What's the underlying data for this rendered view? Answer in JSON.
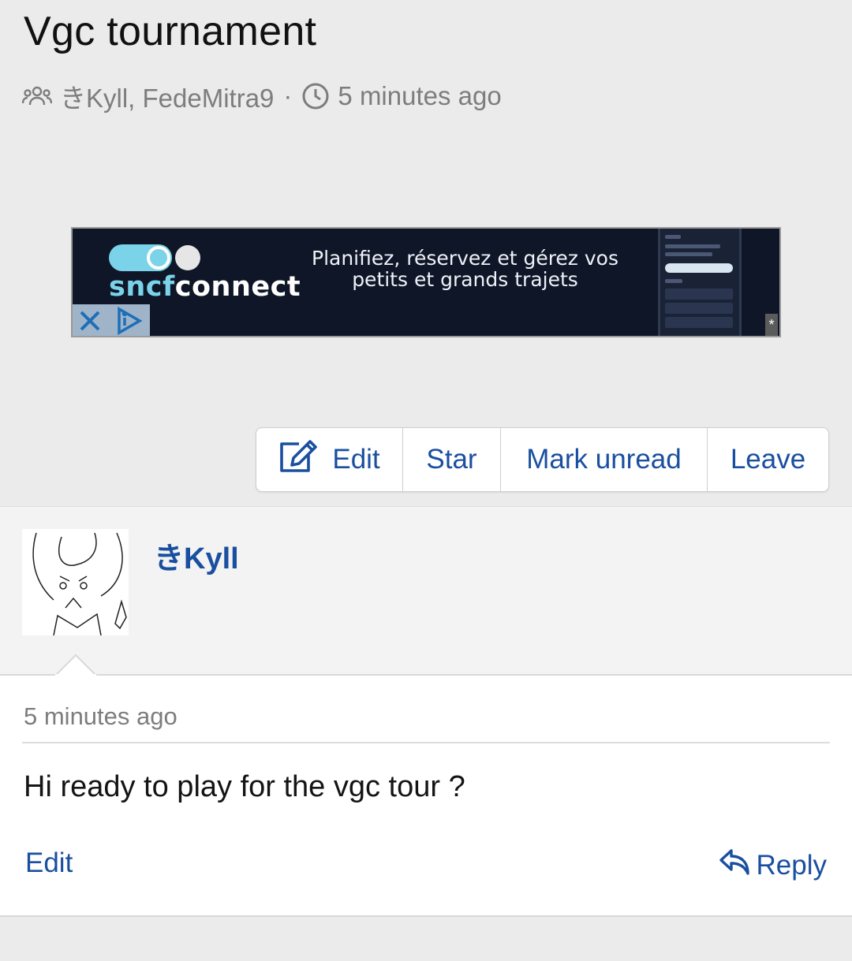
{
  "thread": {
    "title": "Vgc tournament",
    "participants": "きKyll, FedeMitra9",
    "separator": "·",
    "time": "5 minutes ago"
  },
  "ad": {
    "brand_part1": "sncf",
    "brand_part2": "connect",
    "slogan_line1": "Planifiez, réservez et gérez vos",
    "slogan_line2": "petits et grands trajets",
    "star": "*"
  },
  "actions": {
    "edit": "Edit",
    "star": "Star",
    "mark_unread": "Mark unread",
    "leave": "Leave"
  },
  "post": {
    "author": "きKyll",
    "time": "5 minutes ago",
    "text": "Hi ready to play for the vgc tour ?",
    "edit": "Edit",
    "reply": "Reply"
  },
  "colors": {
    "link": "#1a4fa0",
    "muted": "#7d7d7d",
    "background": "#ebebeb",
    "ad_background": "#0f1628",
    "ad_accent": "#7ad3e8"
  },
  "icons": {
    "participants": "group-icon",
    "time": "clock-icon",
    "edit": "edit-pencil-icon",
    "reply": "reply-arrow-icon",
    "ad_close": "close-icon",
    "ad_info": "adchoices-icon"
  }
}
